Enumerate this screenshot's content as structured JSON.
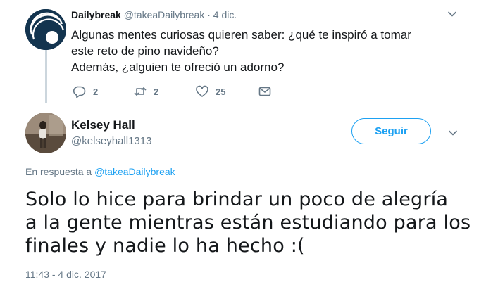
{
  "parent_tweet": {
    "author_name": "Dailybreak",
    "author_handle": "@takeaDailybreak",
    "separator": "·",
    "date": "4 dic.",
    "text_lines": [
      "Algunas mentes curiosas quieren saber: ¿qué te inspiró a tomar",
      "este reto de pino navideño?",
      "Además, ¿alguien te ofreció un adorno?"
    ],
    "actions": {
      "replies": "2",
      "retweets": "2",
      "likes": "25"
    },
    "icons": [
      "reply-icon",
      "retweet-icon",
      "like-icon",
      "direct-message-icon",
      "chevron-down-icon"
    ]
  },
  "reply_tweet": {
    "author_name": "Kelsey Hall",
    "author_handle": "@kelseyhall1313",
    "follow_label": "Seguir",
    "reply_prefix": "En respuesta a",
    "reply_target": "@takeaDailybreak",
    "text_lines": [
      "Solo lo hice para brindar un poco de alegría",
      "a la gente mientras están estudiando para los",
      "finales y nadie lo ha hecho :("
    ],
    "timestamp": "11:43 - 4 dic. 2017"
  },
  "colors": {
    "accent": "#1da1f2",
    "secondary_text": "#657786",
    "primary_text": "#14171a",
    "thread_line": "#ccd6dd"
  }
}
